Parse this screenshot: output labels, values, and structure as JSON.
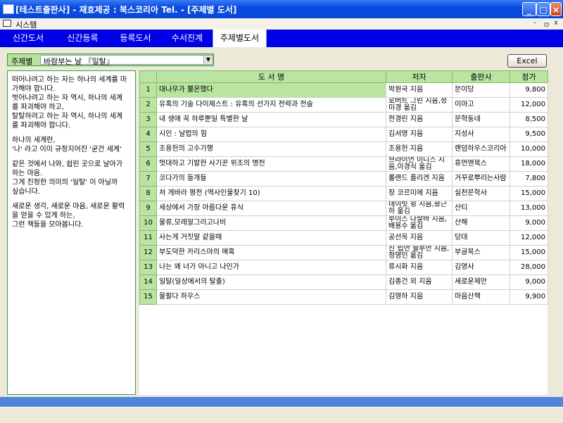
{
  "window": {
    "title": "[테스트출판사] - 재효제공 : 북스코리아 Tel. - [주제별 도서]",
    "btn_min": "_",
    "btn_max": "□",
    "btn_close": "×"
  },
  "menubar": {
    "label": "시스템",
    "ctrl_min": "-",
    "ctrl_restore": "ㅁ",
    "ctrl_close": "x"
  },
  "tabs": [
    {
      "label": "신간도서"
    },
    {
      "label": "신간등록"
    },
    {
      "label": "등록도서"
    },
    {
      "label": "수서진계"
    },
    {
      "label": "주제별도서"
    }
  ],
  "filter": {
    "label": "주제별",
    "value": "바람부는 날 『일탈』",
    "arrow": "▼"
  },
  "excel_label": "Excel",
  "description": [
    "떠어나려고 하는 자는 하나의 세계를 마\n가해야 합니다.\n벗어나려고 하는 자 역시, 하나의 세계\n를 파괴해야 하고,\n탈탈하려고 하는 자 역시, 하나의 세계\n를 파괴해야 합니다.",
    "하나의 세계란,\n'나' 라고 이미 규정지어진 '굳건 세계'",
    "같은 것에서 나와, 쉽린 곳으로 날아가\n하는 마음.\n그게 진정한 의미의 '일탈' 이 아닐까\n싶습니다.",
    "새로운 생각, 새로운 마음, 새로운 활력\n을 얻을 수 있게 하는,\n그런 책들을 모아봅니다."
  ],
  "table": {
    "headers": {
      "num": "",
      "title": "도 서 명",
      "author": "저자",
      "publisher": "출판사",
      "price": "정가"
    },
    "rows": [
      {
        "num": "1",
        "title": "대나무가 뿔온했다",
        "author": "박원국 지음",
        "publisher": "문이당",
        "price": "9,800"
      },
      {
        "num": "2",
        "title": "유혹의 기술 다이제스트 : 유혹의 선가지 전략과 전술",
        "author": "로버트 그린 지음,정미경 옮김",
        "publisher": "이마고",
        "price": "12,000"
      },
      {
        "num": "3",
        "title": "내 생애 꼭 하루뿐일 특별한 날",
        "author": "전경린 지음",
        "publisher": "문학동네",
        "price": "8,500"
      },
      {
        "num": "4",
        "title": "시인 : 날렵의 힘",
        "author": "김서영 지음",
        "publisher": "지성사",
        "price": "9,500"
      },
      {
        "num": "5",
        "title": "조용헌의 고수기행",
        "author": "조용헌 지음",
        "publisher": "랜덤하우스코리아",
        "price": "10,000"
      },
      {
        "num": "6",
        "title": "멋대하고 기발한 사기꾼 위조의 명전",
        "author": "브라이언 이니스 지음,이경식 옮김",
        "publisher": "휴먼앤북스",
        "price": "18,000"
      },
      {
        "num": "7",
        "title": "코다가의 들개들",
        "author": "롤랜드 플리겐 지음",
        "publisher": "거꾸로뿌리는사람",
        "price": "7,800"
      },
      {
        "num": "8",
        "title": "처 게바라 평전 (역사인물찾기 10)",
        "author": "장 코르미에 지음",
        "publisher": "실천문학사",
        "price": "15,000"
      },
      {
        "num": "9",
        "title": "세상에서 가장 아름다운 휴식",
        "author": "데이빗 윙 지음,황근하 옮김",
        "publisher": "산티",
        "price": "13,000"
      },
      {
        "num": "10",
        "title": "물류,모레알그리고나비",
        "author": "루이스 다살바 지음,배용수 옮김",
        "publisher": "산해",
        "price": "9,000"
      },
      {
        "num": "11",
        "title": "사는게 거짓말 같을때",
        "author": "공선옥 지음",
        "publisher": "당대",
        "price": "12,000"
      },
      {
        "num": "12",
        "title": "부도덕한 카리스마의 매혹",
        "author": "진 립먼 블루먼 지음,정영인 옮김",
        "publisher": "부글북스",
        "price": "15,000"
      },
      {
        "num": "13",
        "title": "나는 왜 너가 아니고 나인가",
        "author": "류시화 지음",
        "publisher": "김영사",
        "price": "28,000"
      },
      {
        "num": "14",
        "title": "일탈(일상에서의 탈출)",
        "author": "김종건 외 지음",
        "publisher": "새로운제안",
        "price": "9,000"
      },
      {
        "num": "15",
        "title": "물팔다 하우스",
        "author": "김영하 지음",
        "publisher": "마음산책",
        "price": "9,900"
      }
    ]
  }
}
